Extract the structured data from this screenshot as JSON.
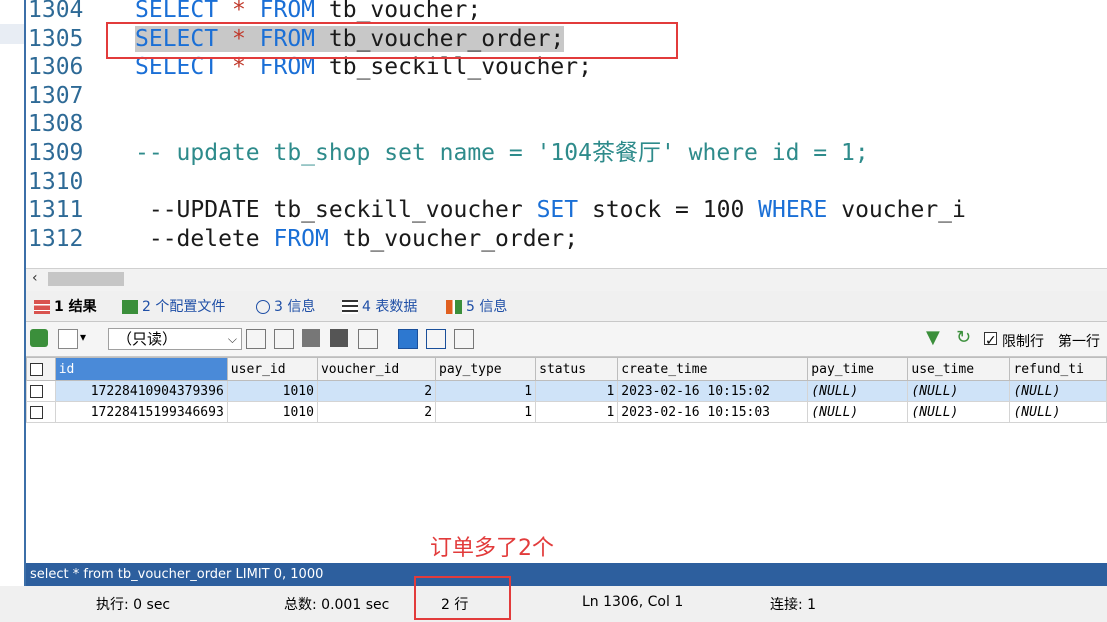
{
  "editor": {
    "lines": [
      {
        "n": "1304",
        "code": [
          {
            "t": "SELECT",
            "c": "kw"
          },
          {
            "t": " * ",
            "c": "op"
          },
          {
            "t": "FROM",
            "c": "kw"
          },
          {
            "t": " tb_voucher;",
            "c": ""
          }
        ]
      },
      {
        "n": "1305",
        "code": [
          {
            "t": "SELECT",
            "c": "kw"
          },
          {
            "t": " * ",
            "c": "op"
          },
          {
            "t": "FROM",
            "c": "kw"
          },
          {
            "t": " tb_voucher_order;",
            "c": ""
          }
        ],
        "selected": true
      },
      {
        "n": "1306",
        "code": [
          {
            "t": "SELECT",
            "c": "kw"
          },
          {
            "t": " * ",
            "c": "op"
          },
          {
            "t": "FROM",
            "c": "kw"
          },
          {
            "t": " tb_seckill_voucher;",
            "c": ""
          }
        ]
      },
      {
        "n": "1307",
        "code": []
      },
      {
        "n": "1308",
        "code": []
      },
      {
        "n": "1309",
        "code": [
          {
            "t": "-- update tb_shop set name = '104茶餐厅' where id = 1;",
            "c": "cm"
          }
        ]
      },
      {
        "n": "1310",
        "code": []
      },
      {
        "n": "1311",
        "code": [
          {
            "t": " --UPDATE tb_seckill_voucher ",
            "c": ""
          },
          {
            "t": "SET",
            "c": "kw"
          },
          {
            "t": " stock = 100 ",
            "c": ""
          },
          {
            "t": "WHERE",
            "c": "kw"
          },
          {
            "t": " voucher_i",
            "c": ""
          }
        ]
      },
      {
        "n": "1312",
        "code": [
          {
            "t": " --delete ",
            "c": ""
          },
          {
            "t": "FROM",
            "c": "kw"
          },
          {
            "t": " tb_voucher_order;",
            "c": ""
          }
        ]
      }
    ]
  },
  "tabs": {
    "result": "1 结果",
    "profile": "2 个配置文件",
    "info": "3 信息",
    "tabledata": "4 表数据",
    "info2": "5 信息"
  },
  "toolbar": {
    "mode": "（只读）",
    "limit_label": "限制行",
    "first_row": "第一行"
  },
  "grid": {
    "columns": [
      "id",
      "user_id",
      "voucher_id",
      "pay_type",
      "status",
      "create_time",
      "pay_time",
      "use_time",
      "refund_ti"
    ],
    "rows": [
      [
        "17228410904379396",
        "1010",
        "2",
        "1",
        "1",
        "2023-02-16 10:15:02",
        "(NULL)",
        "(NULL)",
        "(NULL)"
      ],
      [
        "17228415199346693",
        "1010",
        "2",
        "1",
        "1",
        "2023-02-16 10:15:03",
        "(NULL)",
        "(NULL)",
        "(NULL)"
      ]
    ]
  },
  "status": {
    "query": "select * from tb_voucher_order LIMIT 0, 1000",
    "exec": "执行: 0 sec",
    "total": "总数: 0.001 sec",
    "rows": "2 行",
    "pos": "Ln 1306, Col 1",
    "conn": "连接: 1"
  },
  "annotation": "订单多了2个",
  "colors": {
    "accent": "#2d5f9e",
    "keyword": "#1a6fd6",
    "annotation": "#e23b3b"
  }
}
